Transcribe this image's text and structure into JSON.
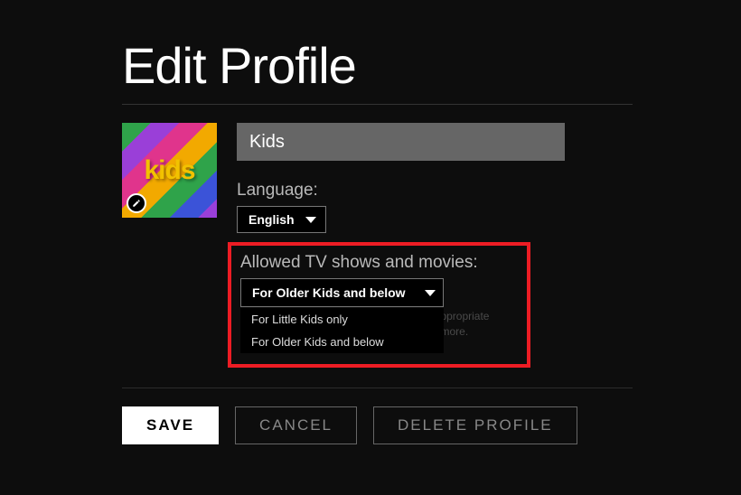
{
  "title": "Edit Profile",
  "profile": {
    "avatar_text": "kids",
    "name_value": "Kids"
  },
  "language": {
    "label": "Language:",
    "selected": "English"
  },
  "maturity": {
    "label": "Allowed TV shows and movies:",
    "selected": "For Older Kids and below",
    "options": [
      "For Little Kids only",
      "For Older Kids and below"
    ],
    "hint": "This profile will only have access to age-appropriate content matching the rating above. Learn more."
  },
  "buttons": {
    "save": "SAVE",
    "cancel": "CANCEL",
    "delete": "DELETE PROFILE"
  }
}
